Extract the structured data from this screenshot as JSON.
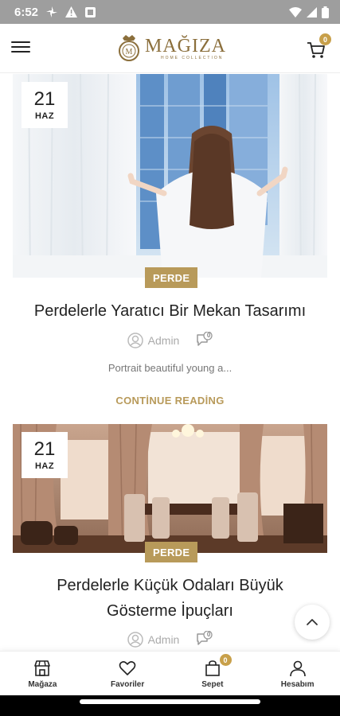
{
  "status_bar": {
    "time": "6:52",
    "icons": [
      "pinwheel-icon",
      "alert-icon",
      "notification-square-icon",
      "wifi-icon",
      "signal-icon",
      "battery-icon"
    ]
  },
  "header": {
    "logo_text": "MAĞIZA",
    "logo_subtitle": "HOME COLLECTION",
    "cart_count": "0"
  },
  "posts": [
    {
      "day": "21",
      "month": "HAZ",
      "category": "PERDE",
      "title": "Perdelerle Yaratıcı Bir Mekan Tasarımı",
      "author": "Admin",
      "comments": "0",
      "excerpt": "Portrait beautiful young a...",
      "continue_label": "CONTİNUE READİNG"
    },
    {
      "day": "21",
      "month": "HAZ",
      "category": "PERDE",
      "title_line1": "Perdelerle Küçük Odaları Büyük",
      "title_line2": "Gösterme İpuçları",
      "author": "Admin",
      "comments": "0"
    }
  ],
  "bottom_nav": {
    "items": [
      {
        "label": "Mağaza",
        "icon": "store-icon"
      },
      {
        "label": "Favoriler",
        "icon": "heart-icon"
      },
      {
        "label": "Sepet",
        "icon": "bag-icon",
        "badge": "0"
      },
      {
        "label": "Hesabım",
        "icon": "user-icon"
      }
    ]
  },
  "colors": {
    "accent": "#b89a5a",
    "badge": "#c8a04a",
    "status_bar": "#9e9e9e"
  }
}
